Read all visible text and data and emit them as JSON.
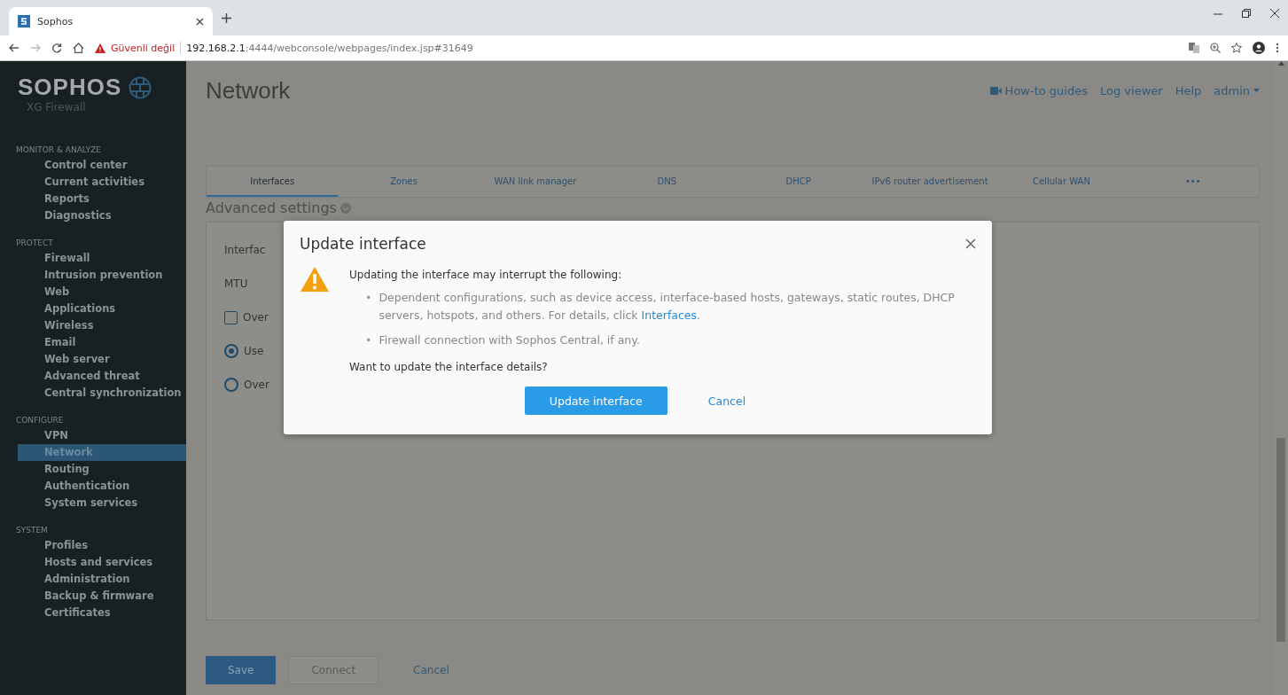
{
  "browser": {
    "tab_title": "Sophos",
    "security_label": "Güvenli değil",
    "url_host": "192.168.2.1",
    "url_rest": ":4444/webconsole/webpages/index.jsp#31649"
  },
  "sidebar": {
    "logo": "SOPHOS",
    "product": "XG Firewall",
    "sections": [
      {
        "title": "MONITOR & ANALYZE",
        "items": [
          {
            "label": "Control center",
            "selected": false
          },
          {
            "label": "Current activities",
            "selected": false
          },
          {
            "label": "Reports",
            "selected": false
          },
          {
            "label": "Diagnostics",
            "selected": false
          }
        ]
      },
      {
        "title": "PROTECT",
        "items": [
          {
            "label": "Firewall",
            "selected": false
          },
          {
            "label": "Intrusion prevention",
            "selected": false
          },
          {
            "label": "Web",
            "selected": false
          },
          {
            "label": "Applications",
            "selected": false
          },
          {
            "label": "Wireless",
            "selected": false
          },
          {
            "label": "Email",
            "selected": false
          },
          {
            "label": "Web server",
            "selected": false
          },
          {
            "label": "Advanced threat",
            "selected": false
          },
          {
            "label": "Central synchronization",
            "selected": false
          }
        ]
      },
      {
        "title": "CONFIGURE",
        "items": [
          {
            "label": "VPN",
            "selected": false
          },
          {
            "label": "Network",
            "selected": true
          },
          {
            "label": "Routing",
            "selected": false
          },
          {
            "label": "Authentication",
            "selected": false
          },
          {
            "label": "System services",
            "selected": false
          }
        ]
      },
      {
        "title": "SYSTEM",
        "items": [
          {
            "label": "Profiles",
            "selected": false
          },
          {
            "label": "Hosts and services",
            "selected": false
          },
          {
            "label": "Administration",
            "selected": false
          },
          {
            "label": "Backup & firmware",
            "selected": false
          },
          {
            "label": "Certificates",
            "selected": false
          }
        ]
      }
    ]
  },
  "page": {
    "title": "Network",
    "header_links": [
      "How-to guides",
      "Log viewer",
      "Help",
      "admin"
    ]
  },
  "tabs": [
    {
      "label": "Interfaces",
      "selected": true
    },
    {
      "label": "Zones",
      "selected": false
    },
    {
      "label": "WAN link manager",
      "selected": false
    },
    {
      "label": "DNS",
      "selected": false
    },
    {
      "label": "DHCP",
      "selected": false
    },
    {
      "label": "IPv6 router advertisement",
      "selected": false
    },
    {
      "label": "Cellular WAN",
      "selected": false
    },
    {
      "label": "•••",
      "selected": false
    }
  ],
  "section_title": "Advanced settings",
  "form": [
    {
      "kind": "label",
      "label": "Interfac"
    },
    {
      "kind": "label",
      "label": "MTU"
    },
    {
      "kind": "checkbox",
      "label": "Over",
      "checked": false
    },
    {
      "kind": "radio",
      "label": "Use",
      "checked": true
    },
    {
      "kind": "radio",
      "label": "Over",
      "checked": false
    }
  ],
  "footer_buttons": [
    {
      "label": "Save",
      "kind": "primary",
      "disabled": false
    },
    {
      "label": "Connect",
      "kind": "secondary",
      "disabled": true
    },
    {
      "label": "Cancel",
      "kind": "link",
      "disabled": false
    }
  ],
  "dialog": {
    "title": "Update interface",
    "intro": "Updating the interface may interrupt the following:",
    "bullets": [
      {
        "marker": "•",
        "text": "Dependent configurations, such as device access, interface-based hosts, gateways, static routes, DHCP servers, hotspots, and others. For details, click ",
        "link": "Interfaces",
        "after": "."
      },
      {
        "marker": "•",
        "text": "Firewall connection with Sophos Central, if any."
      }
    ],
    "question": "Want to update the interface details?",
    "confirm": "Update interface",
    "cancel": "Cancel"
  }
}
